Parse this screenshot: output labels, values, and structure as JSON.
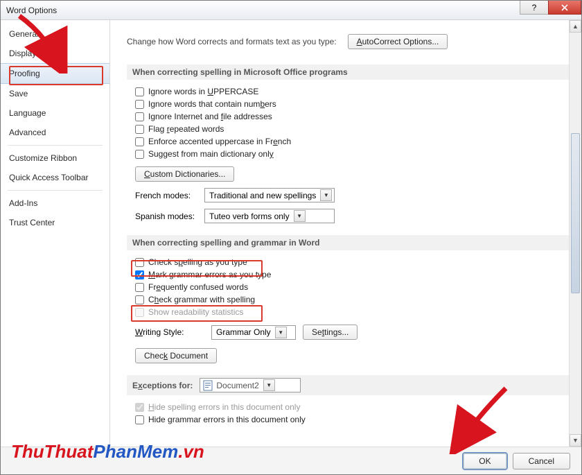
{
  "window": {
    "title": "Word Options"
  },
  "sidebar": {
    "items": [
      {
        "label": "General"
      },
      {
        "label": "Display"
      },
      {
        "label": "Proofing"
      },
      {
        "label": "Save"
      },
      {
        "label": "Language"
      },
      {
        "label": "Advanced"
      },
      {
        "label": "Customize Ribbon"
      },
      {
        "label": "Quick Access Toolbar"
      },
      {
        "label": "Add-Ins"
      },
      {
        "label": "Trust Center"
      }
    ],
    "selected_index": 2
  },
  "intro": {
    "text": "Change how Word corrects and formats text as you type:",
    "button": "AutoCorrect Options..."
  },
  "section1": {
    "header": "When correcting spelling in Microsoft Office programs",
    "opts": [
      {
        "label_pre": "Ignore words in ",
        "u": "U",
        "label_post": "PPERCASE",
        "checked": false
      },
      {
        "label_pre": "Ignore words that contain num",
        "u": "b",
        "label_post": "ers",
        "checked": false
      },
      {
        "label_pre": "Ignore Internet and ",
        "u": "f",
        "label_post": "ile addresses",
        "checked": false
      },
      {
        "label_pre": "Flag ",
        "u": "r",
        "label_post": "epeated words",
        "checked": false
      },
      {
        "label_pre": "Enforce accented uppercase in Fr",
        "u": "e",
        "label_post": "nch",
        "checked": false
      },
      {
        "label_pre": "Suggest from main dictionary onl",
        "u": "y",
        "label_post": "",
        "checked": false
      }
    ],
    "custom_dict_btn": "Custom Dictionaries...",
    "french_label": "French modes:",
    "french_value": "Traditional and new spellings",
    "spanish_label": "Spanish modes:",
    "spanish_value": "Tuteo verb forms only"
  },
  "section2": {
    "header": "When correcting spelling and grammar in Word",
    "opts": [
      {
        "label_pre": "Check s",
        "u": "p",
        "label_post": "elling as you type",
        "checked": false
      },
      {
        "label_pre": "",
        "u": "M",
        "label_post": "ark grammar errors as you type",
        "checked": true
      },
      {
        "label_pre": "Fr",
        "u": "e",
        "label_post": "quently confused words",
        "checked": false
      },
      {
        "label_pre": "C",
        "u": "h",
        "label_post": "eck grammar with spelling",
        "checked": false
      },
      {
        "label_pre": "Show readability statistics",
        "u": "",
        "label_post": "",
        "checked": false,
        "disabled": true
      }
    ],
    "writing_style_label": "Writing Style:",
    "writing_style_value": "Grammar Only",
    "settings_btn": "Settings...",
    "check_doc_btn": "Check Document"
  },
  "section3": {
    "header_pre": "E",
    "header_u": "x",
    "header_post": "ceptions for:",
    "doc_value": "Document2",
    "opts": [
      {
        "label_pre": "",
        "u": "H",
        "label_post": "ide spelling errors in this document only",
        "checked": true,
        "disabled": true
      },
      {
        "label_pre": "Hide ",
        "u": "g",
        "label_post": "rammar errors in this document only",
        "checked": false
      }
    ]
  },
  "footer": {
    "ok": "OK",
    "cancel": "Cancel"
  },
  "watermark": {
    "part1": "ThuThuat",
    "part2": "PhanMem",
    "part3": ".vn"
  }
}
